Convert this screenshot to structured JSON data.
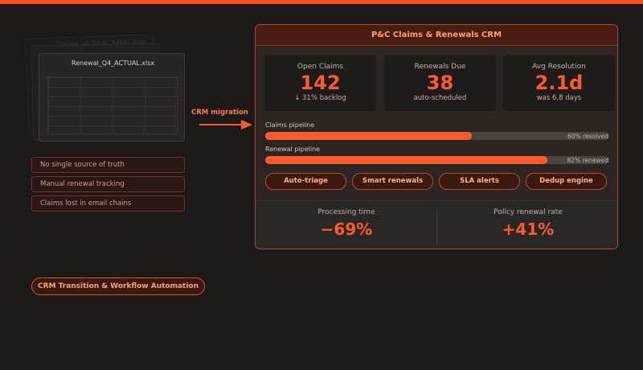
{
  "colors": {
    "accent": "#ff5a2e",
    "background": "#1c1a19",
    "panel": "#2d2522"
  },
  "files": {
    "back_name": "Claims_v8_REAL_FINAL.xlsx",
    "front_name": "Renewal_Q4_ACTUAL.xlsx"
  },
  "pain_points": [
    "No single source of truth",
    "Manual renewal tracking",
    "Claims lost in email chains"
  ],
  "migration_label": "CRM migration",
  "bottom_chip": "CRM Transition & Workflow Automation",
  "crm": {
    "title": "P&C Claims & Renewals CRM",
    "kpis": [
      {
        "label": "Open Claims",
        "value": "142",
        "sub": "↓ 31% backlog"
      },
      {
        "label": "Renewals Due",
        "value": "38",
        "sub": "auto-scheduled"
      },
      {
        "label": "Avg Resolution",
        "value": "2.1d",
        "sub": "was 6.8 days"
      }
    ],
    "pipelines": [
      {
        "label": "Claims pipeline",
        "progress": 0.6,
        "note": "60% resolved"
      },
      {
        "label": "Renewal pipeline",
        "progress": 0.82,
        "note": "82% renewed"
      }
    ],
    "features": [
      "Auto-triage",
      "Smart renewals",
      "SLA alerts",
      "Dedup engine"
    ],
    "stats": [
      {
        "label": "Processing time",
        "value": "−69%"
      },
      {
        "label": "Policy renewal rate",
        "value": "+41%"
      }
    ]
  }
}
